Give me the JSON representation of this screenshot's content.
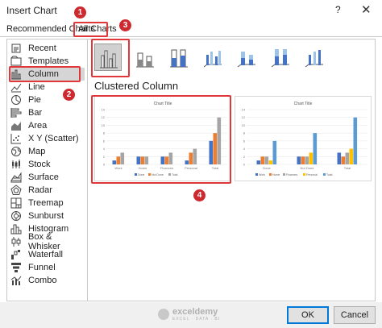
{
  "window": {
    "title": "Insert Chart",
    "help": "?",
    "close": "✕"
  },
  "tabs": {
    "recommended": "Recommended Charts",
    "all": "All Charts"
  },
  "chart_types": [
    {
      "label": "Recent",
      "icon": "recent-icon"
    },
    {
      "label": "Templates",
      "icon": "templates-icon"
    },
    {
      "label": "Column",
      "icon": "column-chart-icon",
      "selected": true
    },
    {
      "label": "Line",
      "icon": "line-chart-icon"
    },
    {
      "label": "Pie",
      "icon": "pie-chart-icon"
    },
    {
      "label": "Bar",
      "icon": "bar-chart-icon"
    },
    {
      "label": "Area",
      "icon": "area-chart-icon"
    },
    {
      "label": "X Y (Scatter)",
      "icon": "scatter-chart-icon"
    },
    {
      "label": "Map",
      "icon": "map-chart-icon"
    },
    {
      "label": "Stock",
      "icon": "stock-chart-icon"
    },
    {
      "label": "Surface",
      "icon": "surface-chart-icon"
    },
    {
      "label": "Radar",
      "icon": "radar-chart-icon"
    },
    {
      "label": "Treemap",
      "icon": "treemap-chart-icon"
    },
    {
      "label": "Sunburst",
      "icon": "sunburst-chart-icon"
    },
    {
      "label": "Histogram",
      "icon": "histogram-chart-icon"
    },
    {
      "label": "Box & Whisker",
      "icon": "box-whisker-chart-icon"
    },
    {
      "label": "Waterfall",
      "icon": "waterfall-chart-icon"
    },
    {
      "label": "Funnel",
      "icon": "funnel-chart-icon"
    },
    {
      "label": "Combo",
      "icon": "combo-chart-icon"
    }
  ],
  "subtype_heading": "Clustered Column",
  "buttons": {
    "ok": "OK",
    "cancel": "Cancel"
  },
  "watermark": {
    "name": "exceldemy",
    "tagline": "EXCEL · DATA · BI"
  },
  "badges": [
    "1",
    "2",
    "3",
    "4"
  ],
  "colors": {
    "blue": "#4472c4",
    "orange": "#ed7d31",
    "gray": "#a5a5a5",
    "highlight": "#e0373a",
    "badge": "#cd2a30"
  },
  "chart_data": [
    {
      "type": "bar",
      "title": "Chart Title",
      "categories": [
        "Work",
        "Home",
        "Finances",
        "Personal",
        "Total"
      ],
      "series": [
        {
          "name": "Done",
          "values": [
            1,
            2,
            2,
            1,
            6
          ]
        },
        {
          "name": "Not Done",
          "values": [
            2,
            2,
            2,
            3,
            8
          ]
        },
        {
          "name": "Total",
          "values": [
            3,
            2,
            3,
            4,
            12
          ]
        }
      ],
      "yticks": [
        "0",
        "2",
        "4",
        "6",
        "8",
        "10",
        "12",
        "14"
      ],
      "ylim": [
        0,
        14
      ],
      "legend": "bottom"
    },
    {
      "type": "bar",
      "title": "Chart Title",
      "categories": [
        "Done",
        "Not Done",
        "Total"
      ],
      "series": [
        {
          "name": "Work",
          "values": [
            1,
            2,
            3
          ]
        },
        {
          "name": "Home",
          "values": [
            2,
            2,
            2
          ]
        },
        {
          "name": "Finances",
          "values": [
            2,
            2,
            3
          ]
        },
        {
          "name": "Personal",
          "values": [
            1,
            3,
            4
          ]
        },
        {
          "name": "Total",
          "values": [
            6,
            8,
            12
          ]
        }
      ],
      "yticks": [
        "0",
        "2",
        "4",
        "6",
        "8",
        "10",
        "12",
        "14"
      ],
      "ylim": [
        0,
        14
      ],
      "legend": "bottom"
    }
  ]
}
